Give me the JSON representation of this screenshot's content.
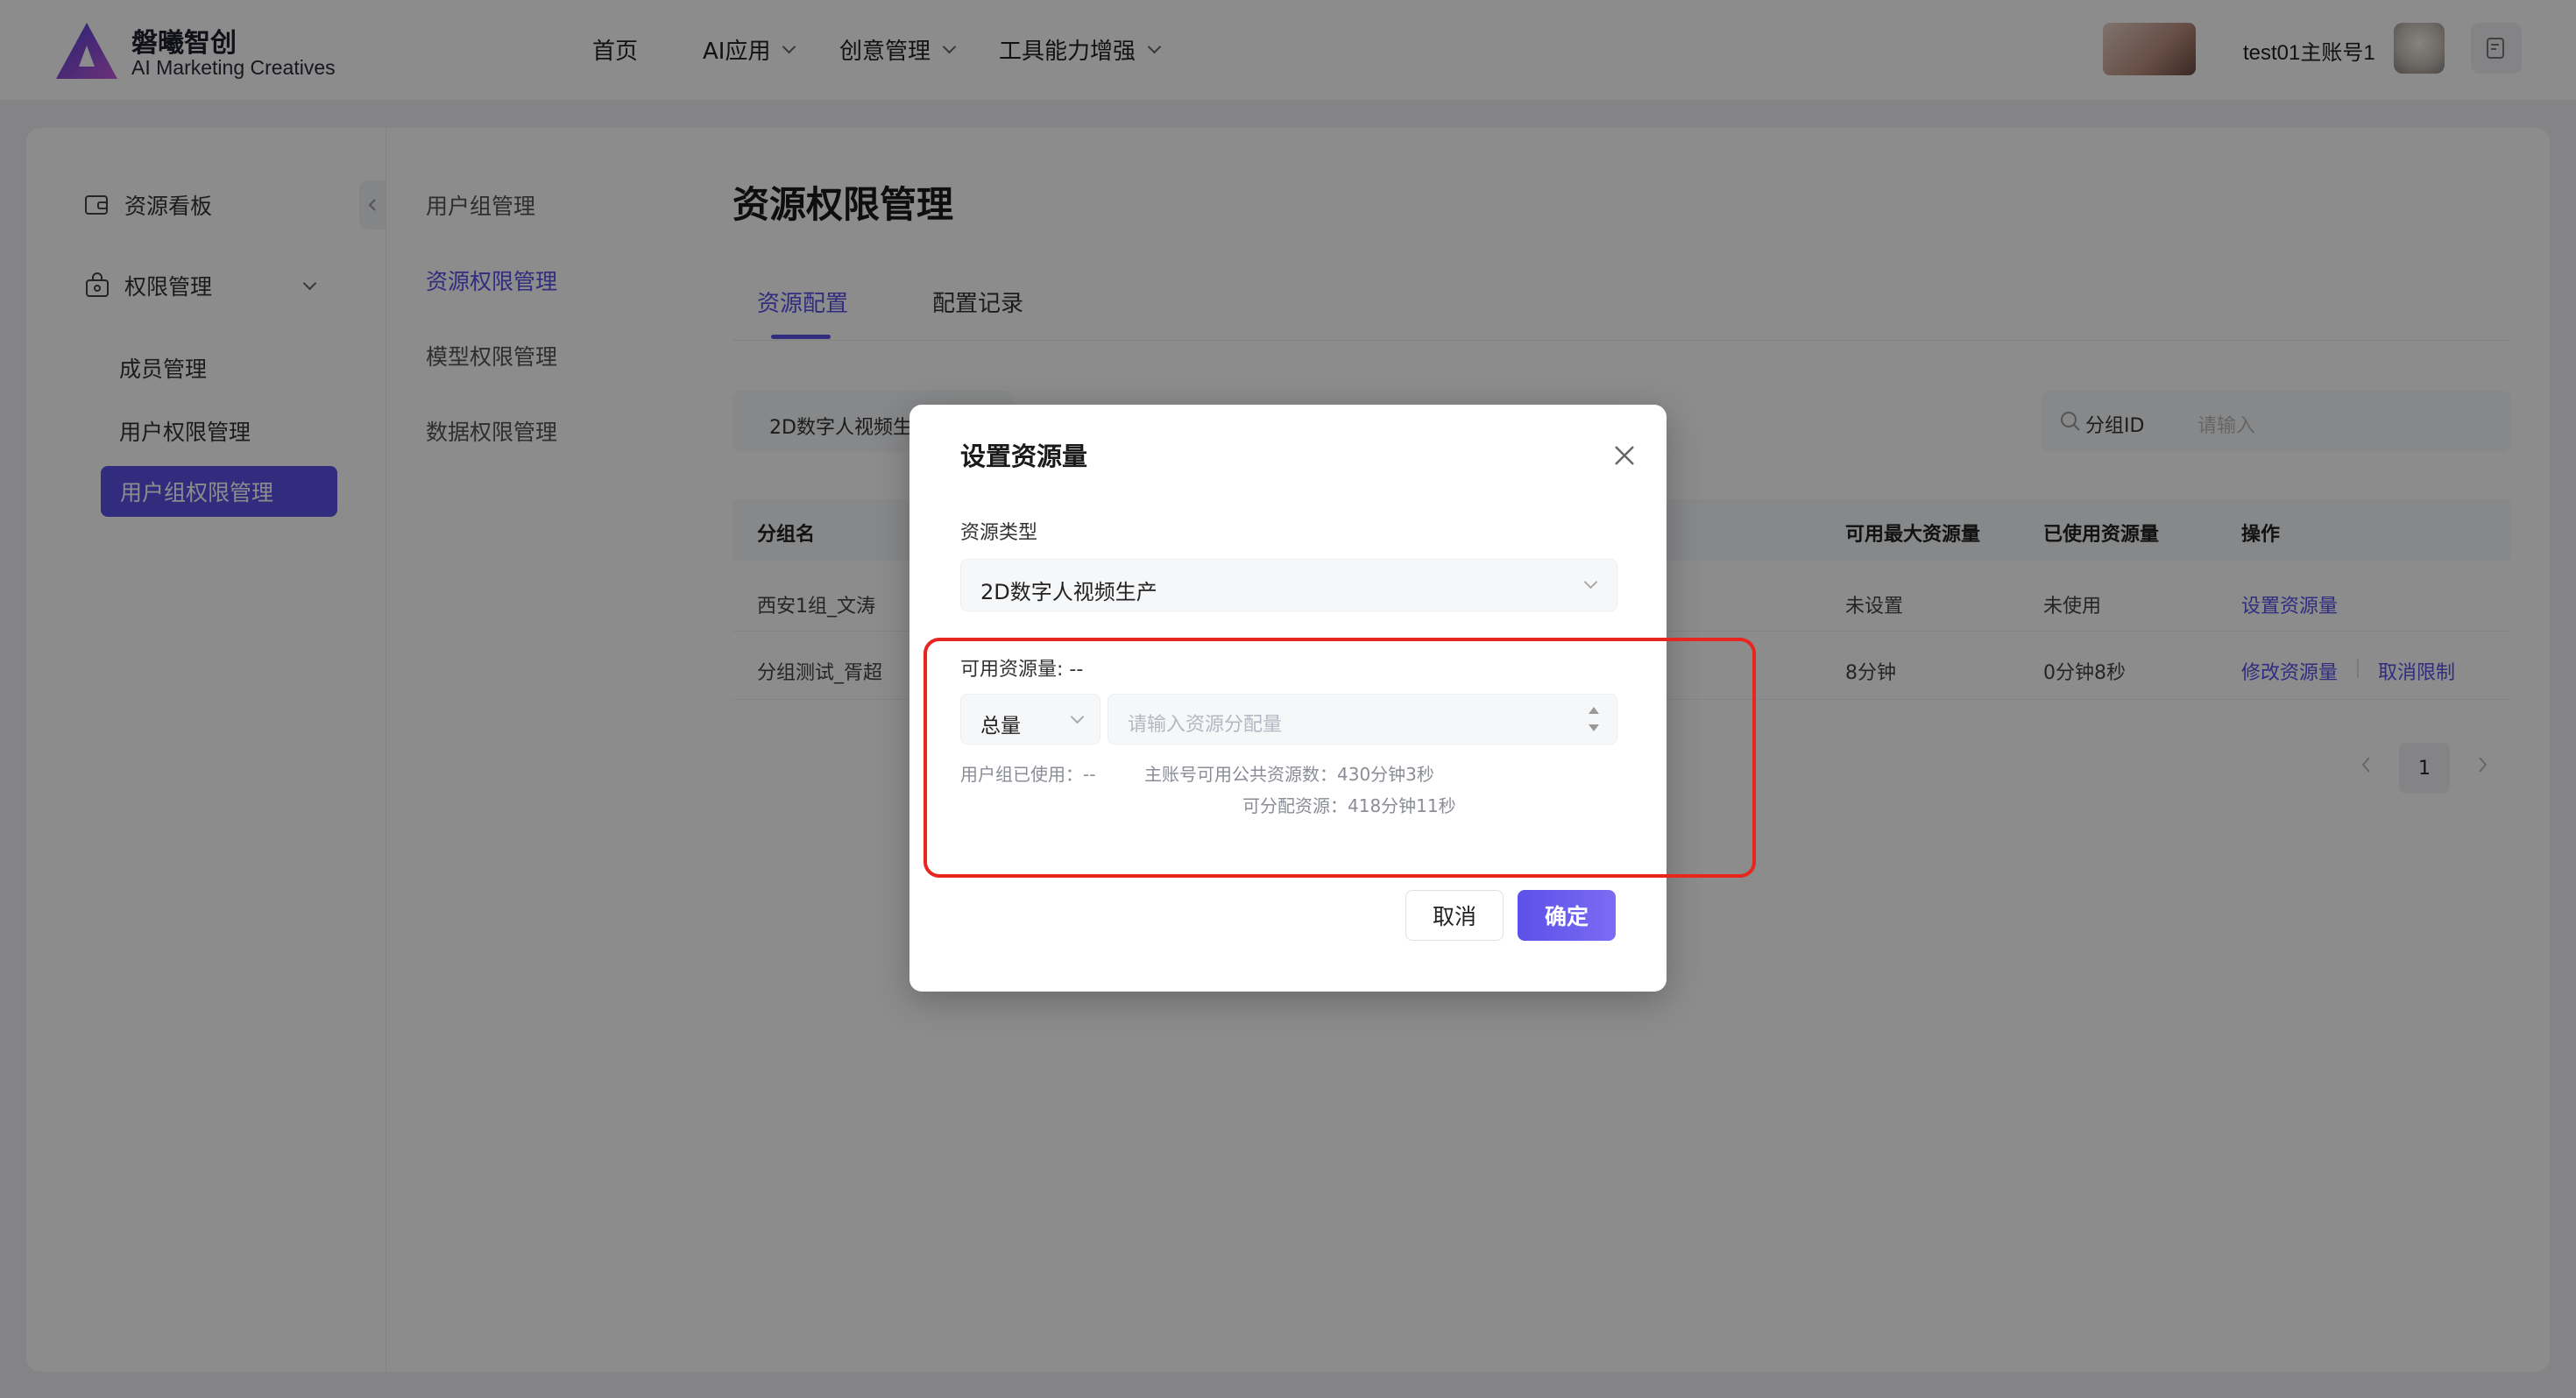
{
  "header": {
    "logo_title": "磐曦智创",
    "logo_sub": "AI Marketing Creatives",
    "nav": [
      {
        "label": "首页",
        "dropdown": false
      },
      {
        "label": "AI应用",
        "dropdown": true
      },
      {
        "label": "创意管理",
        "dropdown": true
      },
      {
        "label": "工具能力增强",
        "dropdown": true
      }
    ],
    "username": "test01主账号1"
  },
  "sidebar": {
    "items": [
      {
        "label": "资源看板",
        "icon": "wallet-icon"
      },
      {
        "label": "权限管理",
        "icon": "lock-briefcase-icon"
      }
    ],
    "sub_items": [
      "成员管理",
      "用户权限管理",
      "用户组权限管理"
    ],
    "active": "用户组权限管理"
  },
  "subnav": [
    "用户组管理",
    "资源权限管理",
    "模型权限管理",
    "数据权限管理"
  ],
  "page": {
    "title": "资源权限管理",
    "tabs": [
      "资源配置",
      "配置记录"
    ],
    "active_tab": "资源配置",
    "filter_value": "2D数字人视频生",
    "search_field": "分组ID",
    "search_placeholder": "请输入"
  },
  "table": {
    "columns": [
      "分组名",
      "可用最大资源量",
      "已使用资源量",
      "操作"
    ],
    "rows": [
      {
        "name": "西安1组_文涛",
        "max": "未设置",
        "used": "未使用",
        "actions": [
          "设置资源量"
        ]
      },
      {
        "name": "分组测试_胥超",
        "max": "8分钟",
        "used": "0分钟8秒",
        "actions": [
          "修改资源量",
          "取消限制"
        ]
      }
    ],
    "page": "1"
  },
  "modal": {
    "title": "设置资源量",
    "resource_type_label": "资源类型",
    "resource_type_value": "2D数字人视频生产",
    "available_label": "可用资源量: --",
    "total_select": "总量",
    "input_placeholder": "请输入资源分配量",
    "hint_used": "用户组已使用：--",
    "hint_public": "主账号可用公共资源数：430分钟3秒",
    "hint_allocatable": "可分配资源：418分钟11秒",
    "cancel": "取消",
    "ok": "确定"
  },
  "colors": {
    "accent": "#5b50e8",
    "highlight": "#e8251f"
  }
}
